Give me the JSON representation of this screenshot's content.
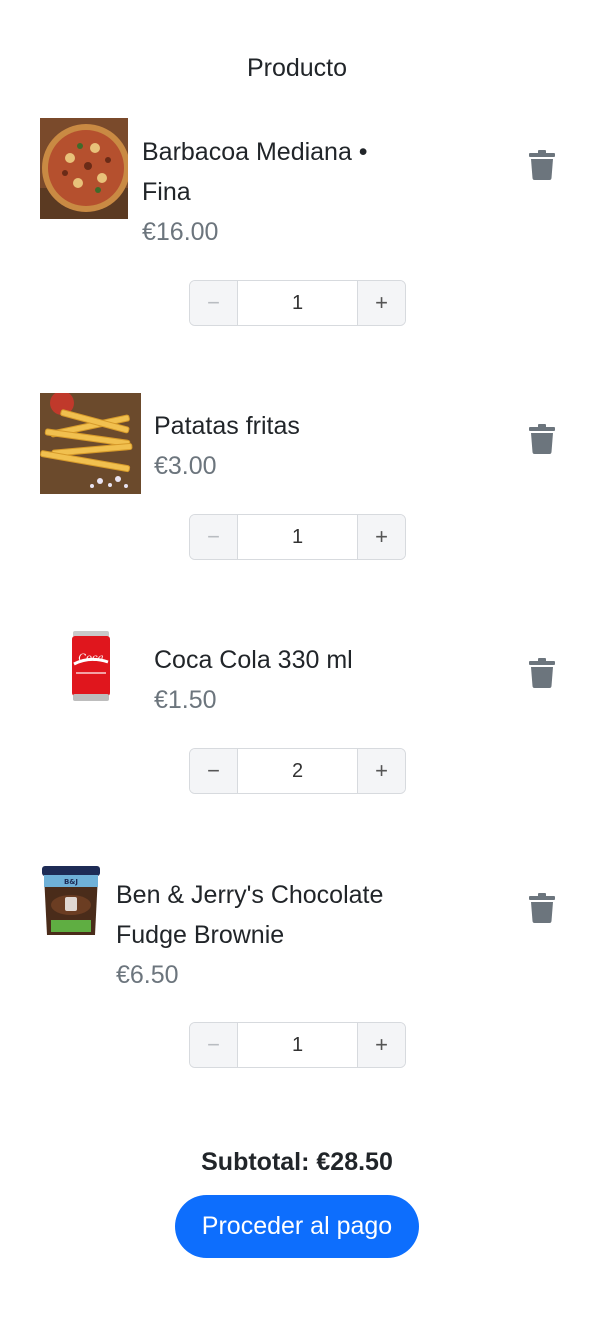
{
  "header": {
    "title": "Producto"
  },
  "items": [
    {
      "name_line1": "Barbacoa Mediana •",
      "name_line2": "Fina",
      "price": "€16.00",
      "qty": "1",
      "minus": "−",
      "plus": "+",
      "image": "pizza"
    },
    {
      "name_line1": "Patatas fritas",
      "name_line2": "",
      "price": "€3.00",
      "qty": "1",
      "minus": "−",
      "plus": "+",
      "image": "fries"
    },
    {
      "name_line1": "Coca Cola 330 ml",
      "name_line2": "",
      "price": "€1.50",
      "qty": "2",
      "minus": "−",
      "plus": "+",
      "image": "coca-cola-can"
    },
    {
      "name_line1": "Ben & Jerry's Chocolate",
      "name_line2": "Fudge Brownie",
      "price": "€6.50",
      "qty": "1",
      "minus": "−",
      "plus": "+",
      "image": "ice-cream-tub"
    }
  ],
  "icons": {
    "delete": "trash-icon",
    "decrement": "minus-icon",
    "increment": "plus-icon"
  },
  "subtotal": {
    "label": "Subtotal: €28.50"
  },
  "checkout": {
    "label": "Proceder al pago"
  },
  "colors": {
    "accent": "#0d6efd",
    "muted": "#6c757d",
    "icon": "#6c757d"
  }
}
